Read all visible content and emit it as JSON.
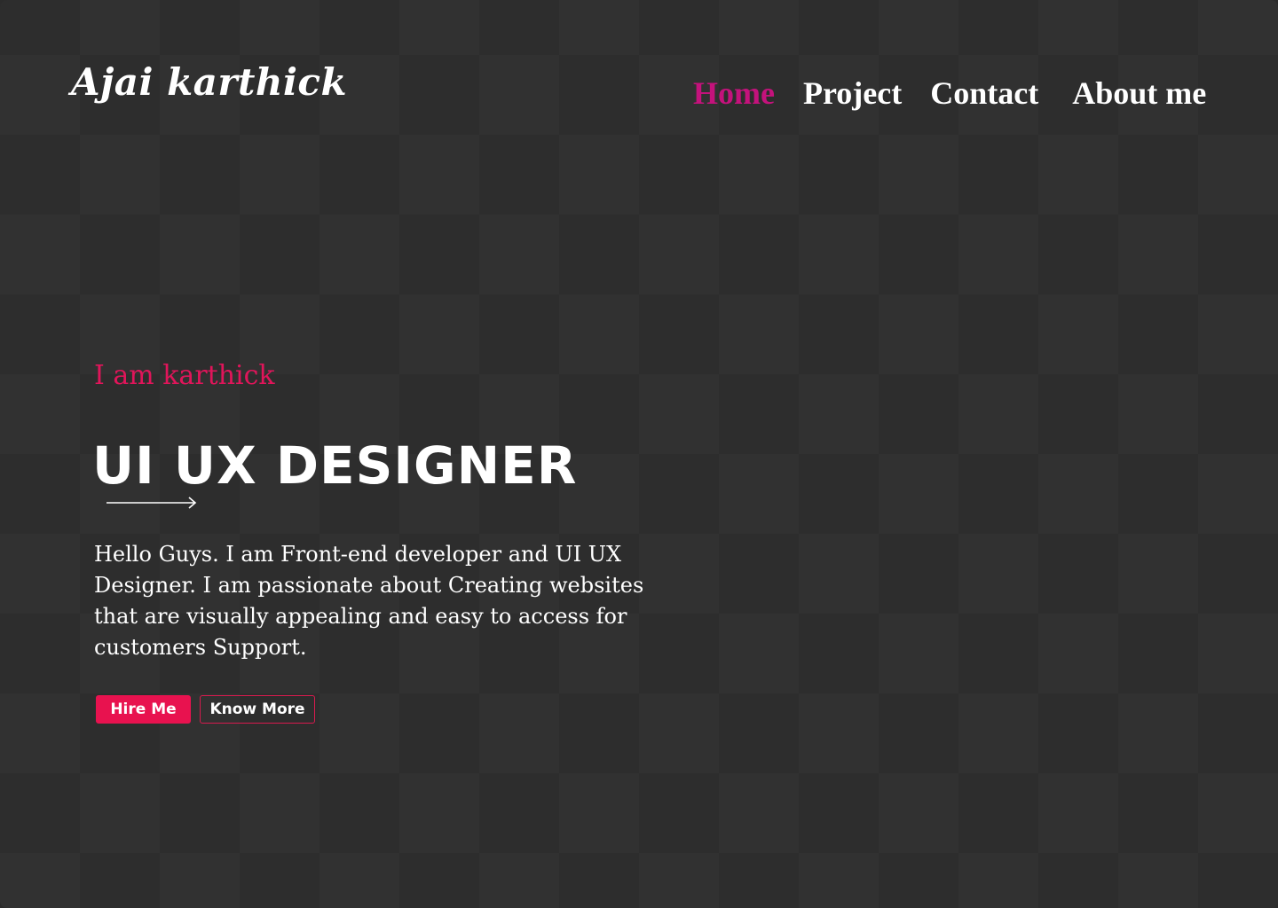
{
  "header": {
    "logo": "Ajai karthick",
    "nav": [
      {
        "label": "Home",
        "active": true
      },
      {
        "label": "Project",
        "active": false
      },
      {
        "label": "Contact",
        "active": false
      },
      {
        "label": "About me",
        "active": false
      }
    ]
  },
  "hero": {
    "intro": "I am karthick",
    "title": "UI UX DESIGNER",
    "description": "Hello Guys. I am Front-end  developer and UI UX Designer. I am passionate about Creating websites that are visually appealing and easy to access  for customers Support.",
    "buttons": {
      "primary": "Hire Me",
      "secondary": "Know More"
    }
  },
  "colors": {
    "background": "#2e2e2e",
    "accent": "#e8124f",
    "nav_active": "#c4127c",
    "text": "#ffffff"
  }
}
